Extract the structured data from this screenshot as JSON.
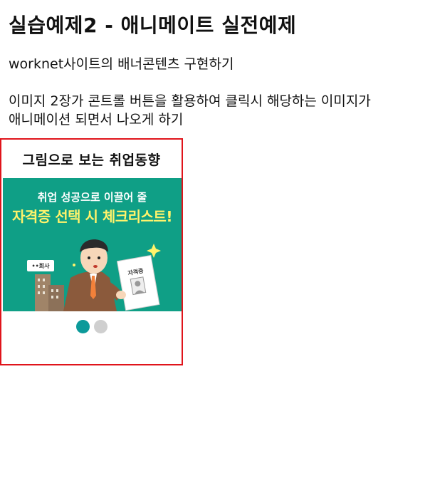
{
  "page": {
    "title": "실습예제2 - 애니메이트 실전예제",
    "description_line1": "worknet사이트의 배너콘텐츠 구현하기",
    "description_line2": "이미지 2장가 콘트롤 버튼을 활용하여 클릭시 해당하는 이미지가",
    "description_line3": "애니메이션 되면서 나오게 하기"
  },
  "banner": {
    "title": "그림으로 보는 취업동향",
    "slide": {
      "headline": "취업 성공으로 이끌어 줄",
      "subheadline": "자격증 선택 시 체크리스트!",
      "sign_label": "••회사",
      "paper_label": "자격증"
    },
    "controls": {
      "active_index": 0,
      "count": 2
    }
  },
  "colors": {
    "border": "#e0141b",
    "slide_background": "#0f9f86",
    "dot_active": "#0c9a9a",
    "dot_inactive": "#cfcfcf",
    "subheadline": "#fff36b"
  }
}
